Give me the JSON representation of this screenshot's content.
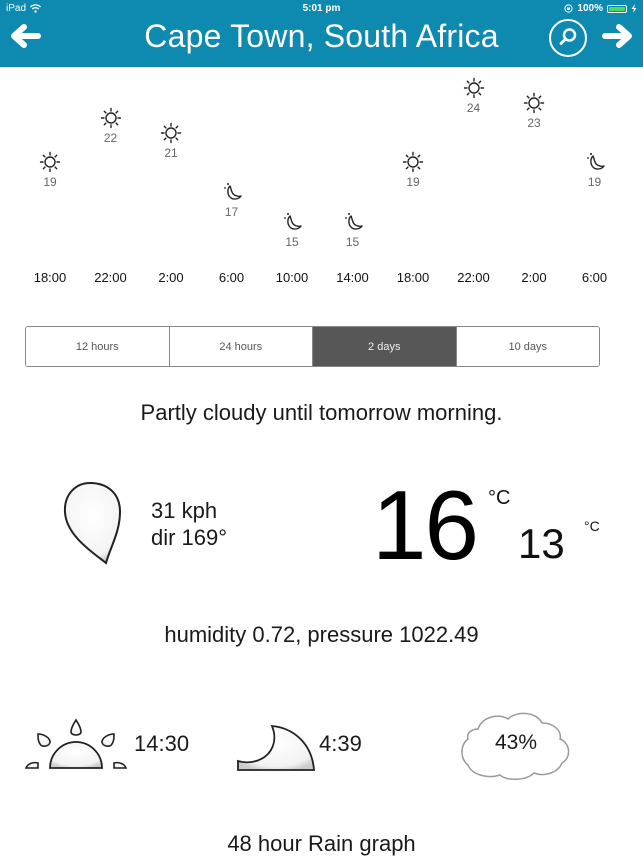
{
  "status_bar": {
    "device": "iPad",
    "time": "5:01 pm",
    "battery": "100%"
  },
  "header": {
    "title": "Cape Town, South Africa",
    "back_icon": "arrow-left-icon",
    "search_icon": "search-icon",
    "forward_icon": "arrow-right-icon",
    "color": "#0e8ab1"
  },
  "forecast": {
    "items": [
      {
        "time": "18:00",
        "temp": "19",
        "icon": "sun"
      },
      {
        "time": "22:00",
        "temp": "22",
        "icon": "sun"
      },
      {
        "time": "2:00",
        "temp": "21",
        "icon": "sun"
      },
      {
        "time": "6:00",
        "temp": "17",
        "icon": "moon"
      },
      {
        "time": "10:00",
        "temp": "15",
        "icon": "moon"
      },
      {
        "time": "14:00",
        "temp": "15",
        "icon": "moon"
      },
      {
        "time": "18:00",
        "temp": "19",
        "icon": "sun"
      },
      {
        "time": "22:00",
        "temp": "24",
        "icon": "sun"
      },
      {
        "time": "2:00",
        "temp": "23",
        "icon": "sun"
      },
      {
        "time": "6:00",
        "temp": "19",
        "icon": "moon"
      }
    ]
  },
  "range_selector": {
    "options": [
      "12 hours",
      "24 hours",
      "2 days",
      "10 days"
    ],
    "selected": "2 days"
  },
  "summary": "Partly cloudy until tomorrow morning.",
  "wind": {
    "speed": "31 kph",
    "direction": "dir 169°"
  },
  "temperature": {
    "current": "16",
    "current_unit": "°C",
    "low": "13",
    "low_unit": "°C"
  },
  "details": "humidity 0.72, pressure 1022.49",
  "sun_moon": {
    "sunrise": "14:30",
    "moonrise": "4:39",
    "cloud_cover": "43%"
  },
  "rain_graph_title": "48 hour Rain graph"
}
